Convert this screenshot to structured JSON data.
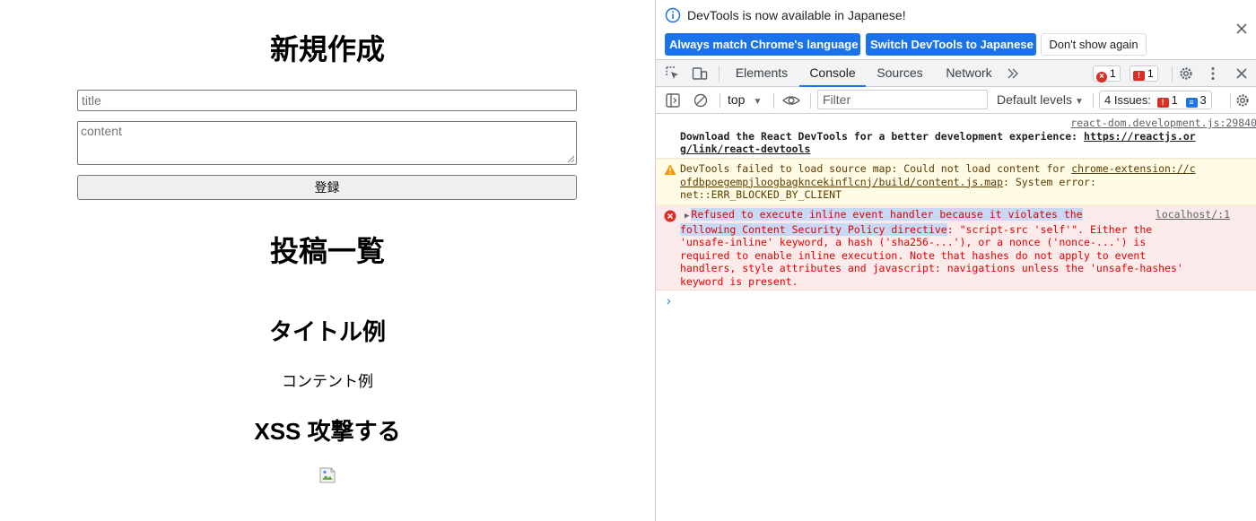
{
  "app": {
    "heading_new": "新規作成",
    "title_placeholder": "title",
    "content_placeholder": "content",
    "submit_label": "登録",
    "heading_list": "投稿一覧",
    "posts": [
      {
        "title": "タイトル例",
        "content": "コンテント例"
      },
      {
        "title": "XSS 攻撃する"
      }
    ]
  },
  "devtools": {
    "infobar": {
      "message": "DevTools is now available in Japanese!",
      "btn_match": "Always match Chrome's language",
      "btn_switch": "Switch DevTools to Japanese",
      "btn_dont_show": "Don't show again"
    },
    "tabs": [
      "Elements",
      "Console",
      "Sources",
      "Network"
    ],
    "active_tab": "Console",
    "error_count": "1",
    "issue_count_badge": "1",
    "toolbar": {
      "context": "top",
      "filter_placeholder": "Filter",
      "levels": "Default levels",
      "issues_label": "4 Issues:",
      "issues_errors": "1",
      "issues_info": "3"
    },
    "messages": {
      "log": {
        "source": "react-dom.development.js:29840",
        "line1": "Download the React DevTools for a better development experience: ",
        "link1": "https://reactjs.or",
        "link2": "g/link/react-devtools"
      },
      "warn": {
        "line1": "DevTools failed to load source map: Could not load content for ",
        "link1": "chrome-extension://c",
        "link2": "ofdbpoegempjloogbagkncekinflcnj/build/content.js.map",
        "line2_tail": ": System error:",
        "line3": "net::ERR_BLOCKED_BY_CLIENT"
      },
      "error": {
        "source": "localhost/:1",
        "hl1": "Refused to execute inline event handler because it violates the",
        "hl2": "following Content Security Policy directive",
        "line2_tail": ": \"script-src 'self'\". Either the",
        "line3": "'unsafe-inline' keyword, a hash ('sha256-...'), or a nonce ('nonce-...') is",
        "line4": "required to enable inline execution. Note that hashes do not apply to event",
        "line5": "handlers, style attributes and javascript: navigations unless the 'unsafe-hashes'",
        "line6": "keyword is present."
      }
    },
    "prompt": "›"
  },
  "colors": {
    "accent": "#1a73e8",
    "error": "#d93025",
    "error_text": "#e40000",
    "warning_bg": "#fffbe5",
    "error_bg": "#fcebeb"
  }
}
